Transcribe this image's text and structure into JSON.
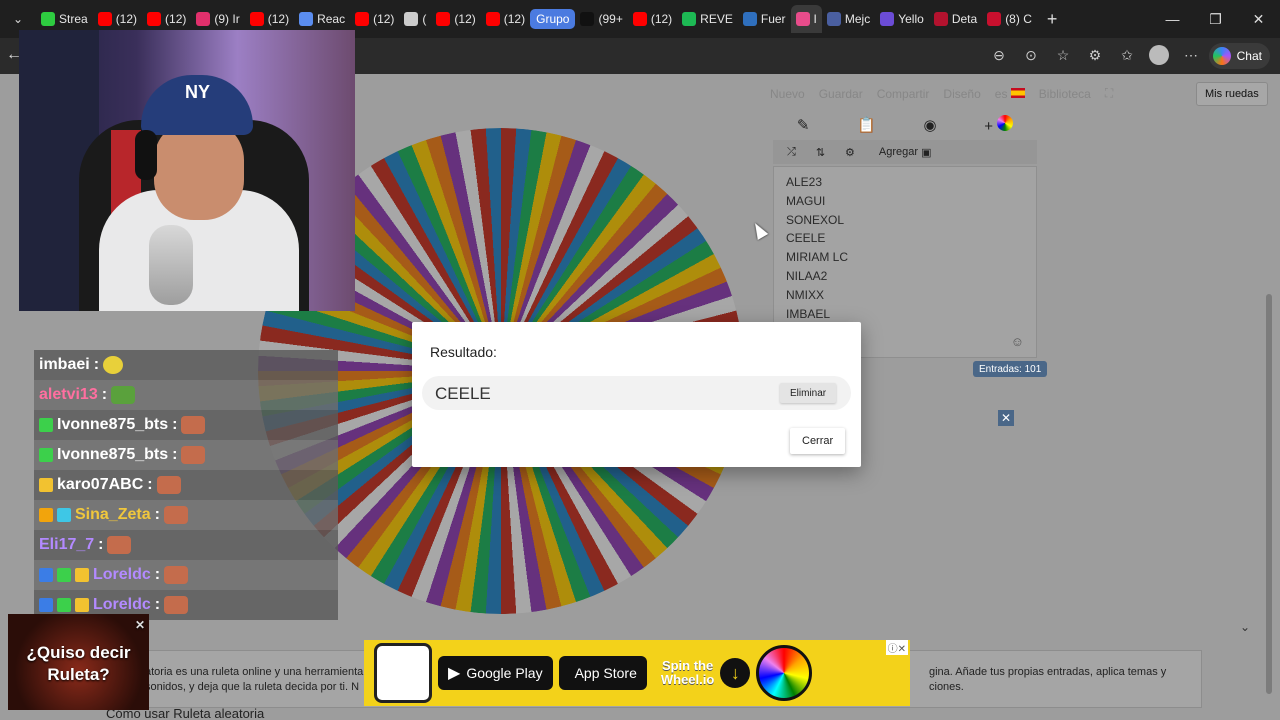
{
  "browser": {
    "tabs": [
      {
        "label": "Strea",
        "color": "#2ecc40"
      },
      {
        "label": "(12)",
        "color": "#ff0000"
      },
      {
        "label": "(12)",
        "color": "#ff0000"
      },
      {
        "label": "(9) Ir",
        "color": "#e1306c"
      },
      {
        "label": "(12)",
        "color": "#ff0000"
      },
      {
        "label": "Reac",
        "color": "#5b8def"
      },
      {
        "label": "(12)",
        "color": "#ff0000"
      },
      {
        "label": "(",
        "color": "#cccccc"
      },
      {
        "label": "(12)",
        "color": "#ff0000"
      },
      {
        "label": "(12)",
        "color": "#ff0000"
      }
    ],
    "group_label": "Grupo",
    "tabs2": [
      {
        "label": "(99+",
        "color": "#111111"
      },
      {
        "label": "(12)",
        "color": "#ff0000"
      },
      {
        "label": "REVE",
        "color": "#1db954"
      },
      {
        "label": "Fuer",
        "color": "#2f6fbd"
      },
      {
        "label": "I",
        "color": "#e84c8b"
      },
      {
        "label": "Mejc",
        "color": "#4a5fa0"
      },
      {
        "label": "Yello",
        "color": "#6b4cd6"
      },
      {
        "label": "Deta",
        "color": "#b3122e"
      },
      {
        "label": "(8) C",
        "color": "#c8102e"
      }
    ],
    "chat_label": "Chat"
  },
  "page": {
    "nav": {
      "nuevo": "Nuevo",
      "guardar": "Guardar",
      "compartir": "Compartir",
      "diseno": "Diseño",
      "lang": "es",
      "biblioteca": "Biblioteca",
      "mis_ruedas": "Mis ruedas"
    },
    "agregar": "Agregar",
    "entries": [
      "ALE23",
      "MAGUI",
      "SONEXOL",
      "CEELE",
      "MIRIAM LC",
      "NILAA2",
      "NMIXX",
      "IMBAEL"
    ],
    "entry_count": "Entradas: 101",
    "footer_left": "atoria es una ruleta online y una herramienta s sonidos, y deja que la ruleta decida por ti. N",
    "footer_right": "gina. Añade tus propias entradas, aplica temas y ciones.",
    "how_title": "Cómo usar Ruleta aleatoria"
  },
  "chat": [
    {
      "user": "imbaei",
      "color": "#ffffff",
      "emote": "y",
      "badges": []
    },
    {
      "user": "aletvi13",
      "color": "#ff6fa0",
      "emote": "g",
      "badges": []
    },
    {
      "user": "Ivonne875_bts",
      "color": "#ffffff",
      "emote": "r",
      "badges": [
        "#3cd04b"
      ]
    },
    {
      "user": "Ivonne875_bts",
      "color": "#ffffff",
      "emote": "r",
      "badges": [
        "#3cd04b"
      ]
    },
    {
      "user": "karo07ABC",
      "color": "#ffffff",
      "emote": "r",
      "badges": [
        "#f2c230"
      ]
    },
    {
      "user": "Sina_Zeta",
      "color": "#f0c73c",
      "emote": "r",
      "badges": [
        "#f2a40c",
        "#3ec7e6"
      ]
    },
    {
      "user": "Eli17_7",
      "color": "#b38aff",
      "emote": "r",
      "badges": []
    },
    {
      "user": "Loreldc",
      "color": "#b38aff",
      "emote": "r",
      "badges": [
        "#3b7de6",
        "#3cd04b",
        "#f2c230"
      ]
    },
    {
      "user": "Loreldc",
      "color": "#b38aff",
      "emote": "r",
      "badges": [
        "#3b7de6",
        "#3cd04b",
        "#f2c230"
      ]
    }
  ],
  "promo": {
    "line1": "¿Quiso decir",
    "line2": "Ruleta?"
  },
  "ad": {
    "google_play": "Google Play",
    "app_store": "App Store",
    "spin_line1": "Spin the",
    "spin_line2": "Wheel.io"
  },
  "modal": {
    "title": "Resultado:",
    "result": "CEELE",
    "delete_label": "Eliminar",
    "close_label": "Cerrar"
  }
}
